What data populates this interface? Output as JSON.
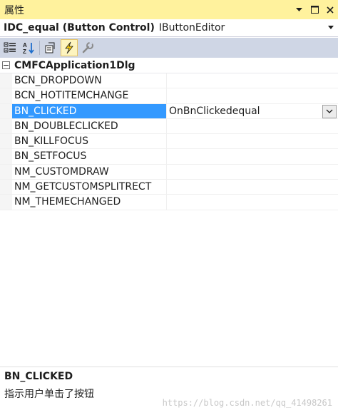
{
  "window": {
    "title": "属性"
  },
  "object_selector": {
    "name": "IDC_equal (Button Control)",
    "type": "IButtonEditor"
  },
  "toolbar": {
    "buttons": [
      {
        "icon": "categorized-icon",
        "active": false
      },
      {
        "icon": "alphabetical-icon",
        "active": false
      },
      {
        "icon": "properties-icon",
        "active": false
      },
      {
        "icon": "control-events-icon",
        "active": true
      },
      {
        "icon": "property-pages-icon",
        "active": false
      }
    ]
  },
  "grid": {
    "category": "CMFCApplication1Dlg",
    "rows": [
      {
        "key": "BCN_DROPDOWN",
        "value": ""
      },
      {
        "key": "BCN_HOTITEMCHANGE",
        "value": ""
      },
      {
        "key": "BN_CLICKED",
        "value": "OnBnClickedequal"
      },
      {
        "key": "BN_DOUBLECLICKED",
        "value": ""
      },
      {
        "key": "BN_KILLFOCUS",
        "value": ""
      },
      {
        "key": "BN_SETFOCUS",
        "value": ""
      },
      {
        "key": "NM_CUSTOMDRAW",
        "value": ""
      },
      {
        "key": "NM_GETCUSTOMSPLITRECT",
        "value": ""
      },
      {
        "key": "NM_THEMECHANGED",
        "value": ""
      }
    ],
    "selected_index": 2
  },
  "description": {
    "title": "BN_CLICKED",
    "text": "指示用户单击了按钮",
    "watermark": "https://blog.csdn.net/qq_41498261"
  },
  "colors": {
    "title_bar": "#fff29d",
    "toolbar": "#cfd6e5",
    "selection": "#3399ff"
  }
}
